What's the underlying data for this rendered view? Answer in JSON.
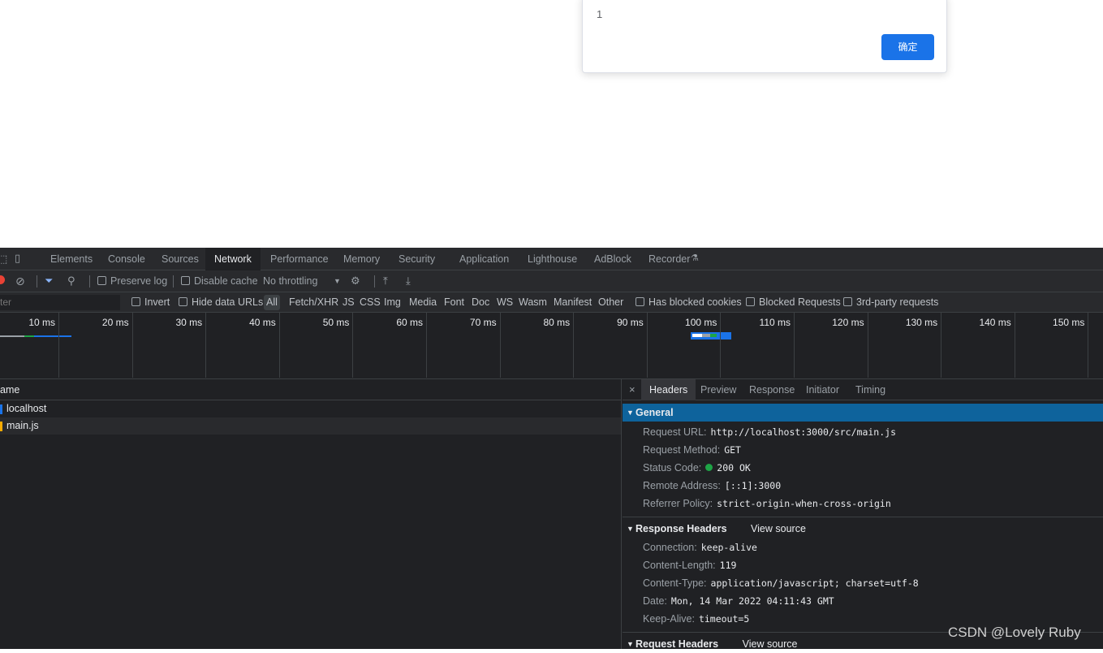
{
  "dialog": {
    "message": "1",
    "confirm_label": "确定"
  },
  "devtools": {
    "tabs": [
      "Elements",
      "Console",
      "Sources",
      "Network",
      "Performance",
      "Memory",
      "Security",
      "Application",
      "Lighthouse",
      "AdBlock",
      "Recorder"
    ],
    "active_tab": "Network",
    "toolbar": {
      "preserve_log": "Preserve log",
      "disable_cache": "Disable cache",
      "throttling": "No throttling"
    },
    "filter": {
      "placeholder": "ter",
      "invert": "Invert",
      "hide_data_urls": "Hide data URLs",
      "types": [
        "All",
        "Fetch/XHR",
        "JS",
        "CSS",
        "Img",
        "Media",
        "Font",
        "Doc",
        "WS",
        "Wasm",
        "Manifest",
        "Other"
      ],
      "has_blocked_cookies": "Has blocked cookies",
      "blocked_requests": "Blocked Requests",
      "third_party": "3rd-party requests"
    },
    "timeline_ticks": [
      "10 ms",
      "20 ms",
      "30 ms",
      "40 ms",
      "50 ms",
      "60 ms",
      "70 ms",
      "80 ms",
      "90 ms",
      "100 ms",
      "110 ms",
      "120 ms",
      "130 ms",
      "140 ms",
      "150 ms"
    ],
    "list": {
      "header": "ame",
      "rows": [
        {
          "name": "localhost",
          "color": "#1a73e8"
        },
        {
          "name": "main.js",
          "color": "#f9ab00"
        }
      ]
    },
    "detail": {
      "tabs": [
        "Headers",
        "Preview",
        "Response",
        "Initiator",
        "Timing"
      ],
      "active_tab": "Headers",
      "general": {
        "title": "General",
        "request_url_k": "Request URL:",
        "request_url_v": "http://localhost:3000/src/main.js",
        "method_k": "Request Method:",
        "method_v": "GET",
        "status_k": "Status Code:",
        "status_v": "200 OK",
        "remote_k": "Remote Address:",
        "remote_v": "[::1]:3000",
        "referrer_k": "Referrer Policy:",
        "referrer_v": "strict-origin-when-cross-origin"
      },
      "response_headers": {
        "title": "Response Headers",
        "view_source": "View source",
        "connection_k": "Connection:",
        "connection_v": "keep-alive",
        "length_k": "Content-Length:",
        "length_v": "119",
        "type_k": "Content-Type:",
        "type_v": "application/javascript; charset=utf-8",
        "date_k": "Date:",
        "date_v": "Mon, 14 Mar 2022 04:11:43 GMT",
        "keepalive_k": "Keep-Alive:",
        "keepalive_v": "timeout=5"
      },
      "request_headers": {
        "title": "Request Headers",
        "view_source": "View source"
      }
    }
  },
  "watermark": "CSDN @Lovely Ruby"
}
